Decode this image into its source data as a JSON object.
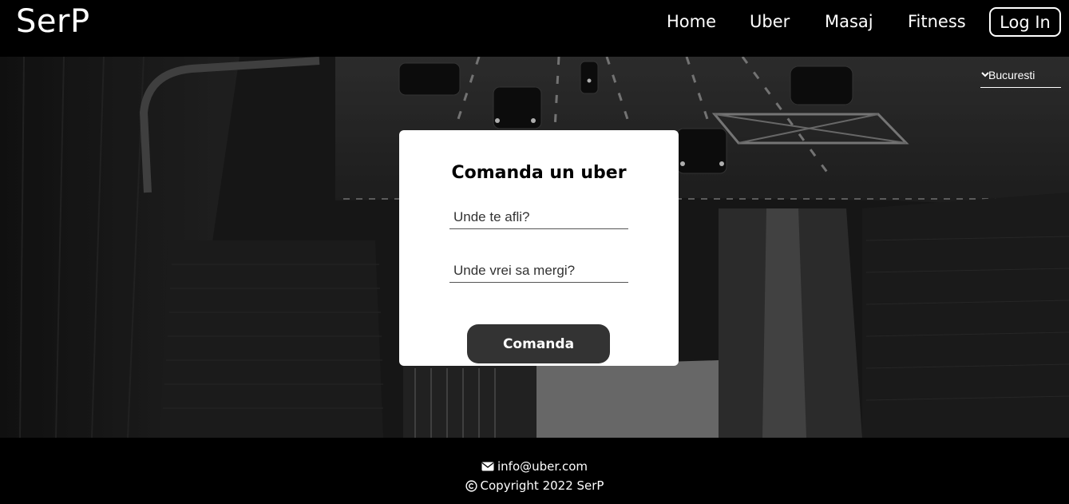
{
  "header": {
    "brand": "SerP",
    "nav": [
      "Home",
      "Uber",
      "Masaj",
      "Fitness"
    ],
    "login_label": "Log In"
  },
  "city_select": {
    "selected": "Bucuresti"
  },
  "order_form": {
    "title": "Comanda un uber",
    "from_placeholder": "Unde te afli?",
    "to_placeholder": "Unde vrei sa mergi?",
    "submit_label": "Comanda"
  },
  "footer": {
    "email": "info@uber.com",
    "copyright": "Copyright 2022 SerP"
  },
  "icons": {
    "email": "envelope-icon",
    "copyright": "copyright-icon",
    "select": "chevron-down-icon"
  },
  "colors": {
    "background": "#000000",
    "card": "#ffffff",
    "button": "#333333"
  }
}
